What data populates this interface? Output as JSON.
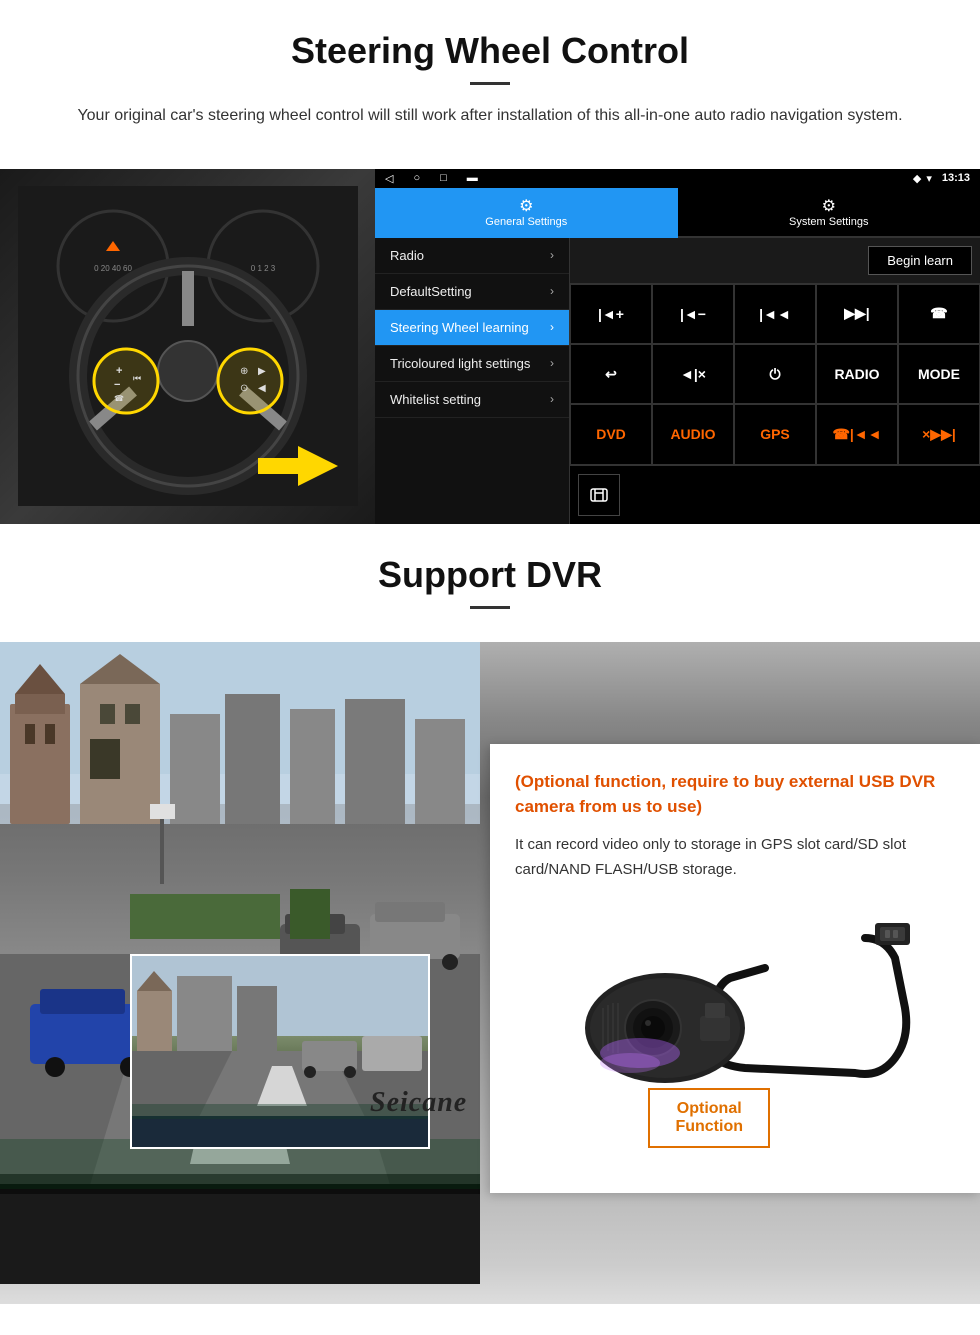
{
  "steering_section": {
    "title": "Steering Wheel Control",
    "subtitle": "Your original car's steering wheel control will still work after installation of this all-in-one auto radio navigation system.",
    "android_ui": {
      "status_bar": {
        "time": "13:13",
        "signal_icon": "▼",
        "wifi_icon": "▾"
      },
      "tabs": [
        {
          "icon": "⚙",
          "label": "General Settings",
          "active": true
        },
        {
          "icon": "⚙",
          "label": "System Settings",
          "active": false
        }
      ],
      "menu_items": [
        {
          "label": "Radio",
          "active": false
        },
        {
          "label": "DefaultSetting",
          "active": false
        },
        {
          "label": "Steering Wheel learning",
          "active": true
        },
        {
          "label": "Tricoloured light settings",
          "active": false
        },
        {
          "label": "Whitelist setting",
          "active": false
        }
      ],
      "begin_learn_label": "Begin learn",
      "control_buttons": [
        "|◄+",
        "|◄−",
        "|◄◄",
        "▶▶|",
        "☎",
        "↩",
        "◄|×",
        "⏻",
        "RADIO",
        "MODE",
        "DVD",
        "AUDIO",
        "GPS",
        "☎|◄◄",
        "×▶▶|"
      ]
    }
  },
  "dvr_section": {
    "title": "Support DVR",
    "optional_title": "(Optional function, require to buy external USB DVR camera from us to use)",
    "description": "It can record video only to storage in GPS slot card/SD slot card/NAND FLASH/USB storage.",
    "optional_function_label": "Optional Function",
    "seicane_logo": "Seicane"
  }
}
